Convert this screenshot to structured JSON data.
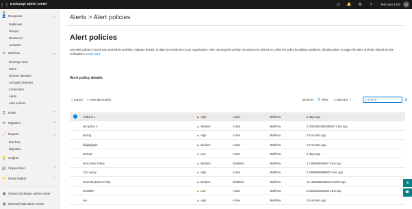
{
  "app": {
    "title": "Exchange admin center",
    "user": "Test User 1234",
    "initials": "TU"
  },
  "sidebar": {
    "items": [
      {
        "label": "Recipients",
        "icon": "person-icon",
        "expanded": true
      },
      {
        "label": "Mail flow",
        "icon": "mail-flow-icon",
        "expanded": true
      },
      {
        "label": "Roles",
        "icon": "roles-icon",
        "expanded": false
      },
      {
        "label": "Migration",
        "icon": "migration-icon",
        "expanded": false
      },
      {
        "label": "Reports",
        "icon": "reports-icon",
        "expanded": true
      },
      {
        "label": "Insights",
        "icon": "insights-icon",
        "expanded": false
      },
      {
        "label": "Organization",
        "icon": "organization-icon",
        "expanded": false
      },
      {
        "label": "Public folders",
        "icon": "folder-icon",
        "expanded": false
      }
    ],
    "recipients_sub": [
      "Mailboxes",
      "Groups",
      "Resources",
      "Contacts"
    ],
    "mailflow_sub": [
      "Message trace",
      "Rules",
      "Remote domains",
      "Accepted domains",
      "Connectors",
      "Alerts",
      "Alert policies"
    ],
    "reports_sub": [
      "Mail flow",
      "Migration"
    ],
    "footer": [
      "Classic Exchange admin center",
      "Microsoft 365 admin center"
    ]
  },
  "main": {
    "breadcrumb_parent": "Alerts",
    "breadcrumb_sep": ">",
    "breadcrumb_current": "Alert policies",
    "title": "Alert policies",
    "description": "Use alert policies to track user and admin activities, malware threats, or data loss incidents in your organization. After choosing the activity you want to be alerted on, refine the policy by adding conditions, deciding when to trigger the alert, and who should receive notifications.",
    "learn_more": "Learn more",
    "section_title": "Alert policy details"
  },
  "toolbar": {
    "export": "Export",
    "new": "New alert policy",
    "items_count": "60 items",
    "filter": "Filter",
    "selected": "1 selected",
    "search_placeholder": "Search"
  },
  "table": {
    "headers": [
      "Alert name",
      "Severity",
      "Status",
      "Category",
      "Last occurrence"
    ],
    "rows": [
      {
        "name": "CHECK 1",
        "severity": "High",
        "status": "Active",
        "category": "MailFlow",
        "last": "6 days ago",
        "selected": true
      },
      {
        "name": "test policy 2",
        "severity": "Medium",
        "status": "Active",
        "category": "MailFlow",
        "last": "2.00000000000000667 mins ago",
        "selected": false
      },
      {
        "name": "testing",
        "severity": "High",
        "status": "Active",
        "category": "MailFlow",
        "last": "3.8 months ago",
        "selected": false
      },
      {
        "name": "fddghghgds",
        "severity": "Medium",
        "status": "Active",
        "category": "MailFlow",
        "last": "3.8 months ago",
        "selected": false
      },
      {
        "name": "test123",
        "severity": "Low",
        "status": "Active",
        "category": "MailFlow",
        "last": "6 days ago",
        "selected": false
      },
      {
        "name": "test123abc Policy",
        "severity": "Medium",
        "status": "Disabled",
        "category": "MailFlow",
        "last": "4.1666666666667 mins ago",
        "selected": false
      },
      {
        "name": "Cert expiry",
        "severity": "High",
        "status": "Active",
        "category": "MailFlow",
        "last": "2.38888888888887 mins ago",
        "selected": false
      },
      {
        "name": "testPolicy1abc6 Policy",
        "severity": "Medium",
        "status": "Disabled",
        "category": "MailFlow",
        "last": "11.1666666666666 months ago",
        "selected": false
      },
      {
        "name": "test9999",
        "severity": "Low",
        "status": "Active",
        "category": "MailFlow",
        "last": "2.8333333333333 mins ago",
        "selected": false
      },
      {
        "name": "ww",
        "severity": "High",
        "status": "Active",
        "category": "MailFlow",
        "last": "3.6 months ago",
        "selected": false
      }
    ]
  },
  "colors": {
    "accent": "#0078d4",
    "high": "#d13438",
    "medium": "#d13438",
    "low": "#c19c00",
    "topbar": "#1b1a19",
    "fab": "#038387"
  }
}
